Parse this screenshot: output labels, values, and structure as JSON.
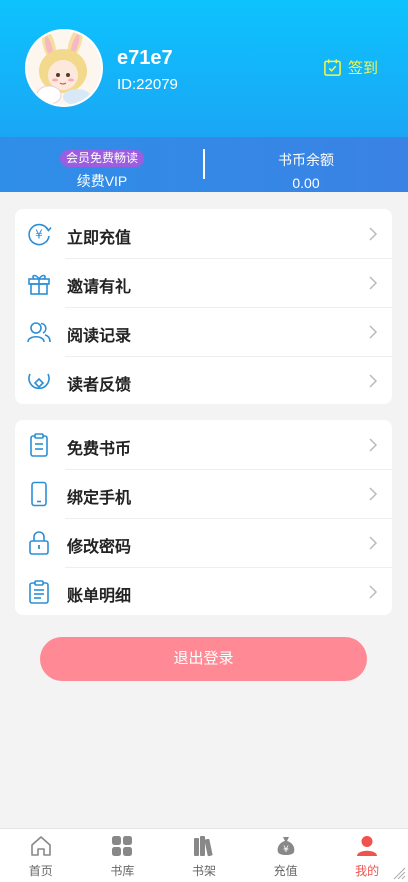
{
  "user": {
    "name": "e71e7",
    "id_text": "ID:22079",
    "checkin_label": "签到"
  },
  "vip": {
    "badge": "会员免费畅读",
    "renew_label": "续费VIP",
    "coin_label": "书币余额",
    "coin_value": "0.00"
  },
  "menu_group_1": [
    {
      "label": "立即充值",
      "icon": "recharge-coin-icon"
    },
    {
      "label": "邀请有礼",
      "icon": "gift-icon"
    },
    {
      "label": "阅读记录",
      "icon": "users-icon"
    },
    {
      "label": "读者反馈",
      "icon": "feedback-icon"
    }
  ],
  "menu_group_2": [
    {
      "label": "免费书币",
      "icon": "clipboard-icon"
    },
    {
      "label": "绑定手机",
      "icon": "phone-icon"
    },
    {
      "label": "修改密码",
      "icon": "lock-icon"
    },
    {
      "label": "账单明细",
      "icon": "bill-icon"
    }
  ],
  "logout_label": "退出登录",
  "tabs": [
    {
      "label": "首页",
      "icon": "home-icon",
      "active": false
    },
    {
      "label": "书库",
      "icon": "grid-icon",
      "active": false
    },
    {
      "label": "书架",
      "icon": "bookshelf-icon",
      "active": false
    },
    {
      "label": "充值",
      "icon": "moneybag-icon",
      "active": false
    },
    {
      "label": "我的",
      "icon": "person-icon",
      "active": true
    }
  ],
  "colors": {
    "header_top": "#0dc3fd",
    "header_bottom": "#1aa6f5",
    "vip_bar": "#3a82e4",
    "vip_badge": "#9b5ee0",
    "checkin_yellow": "#f8f64a",
    "icon_blue": "#2b8fd6",
    "logout_pink": "#ff8a95",
    "tab_active": "#f0524d"
  }
}
